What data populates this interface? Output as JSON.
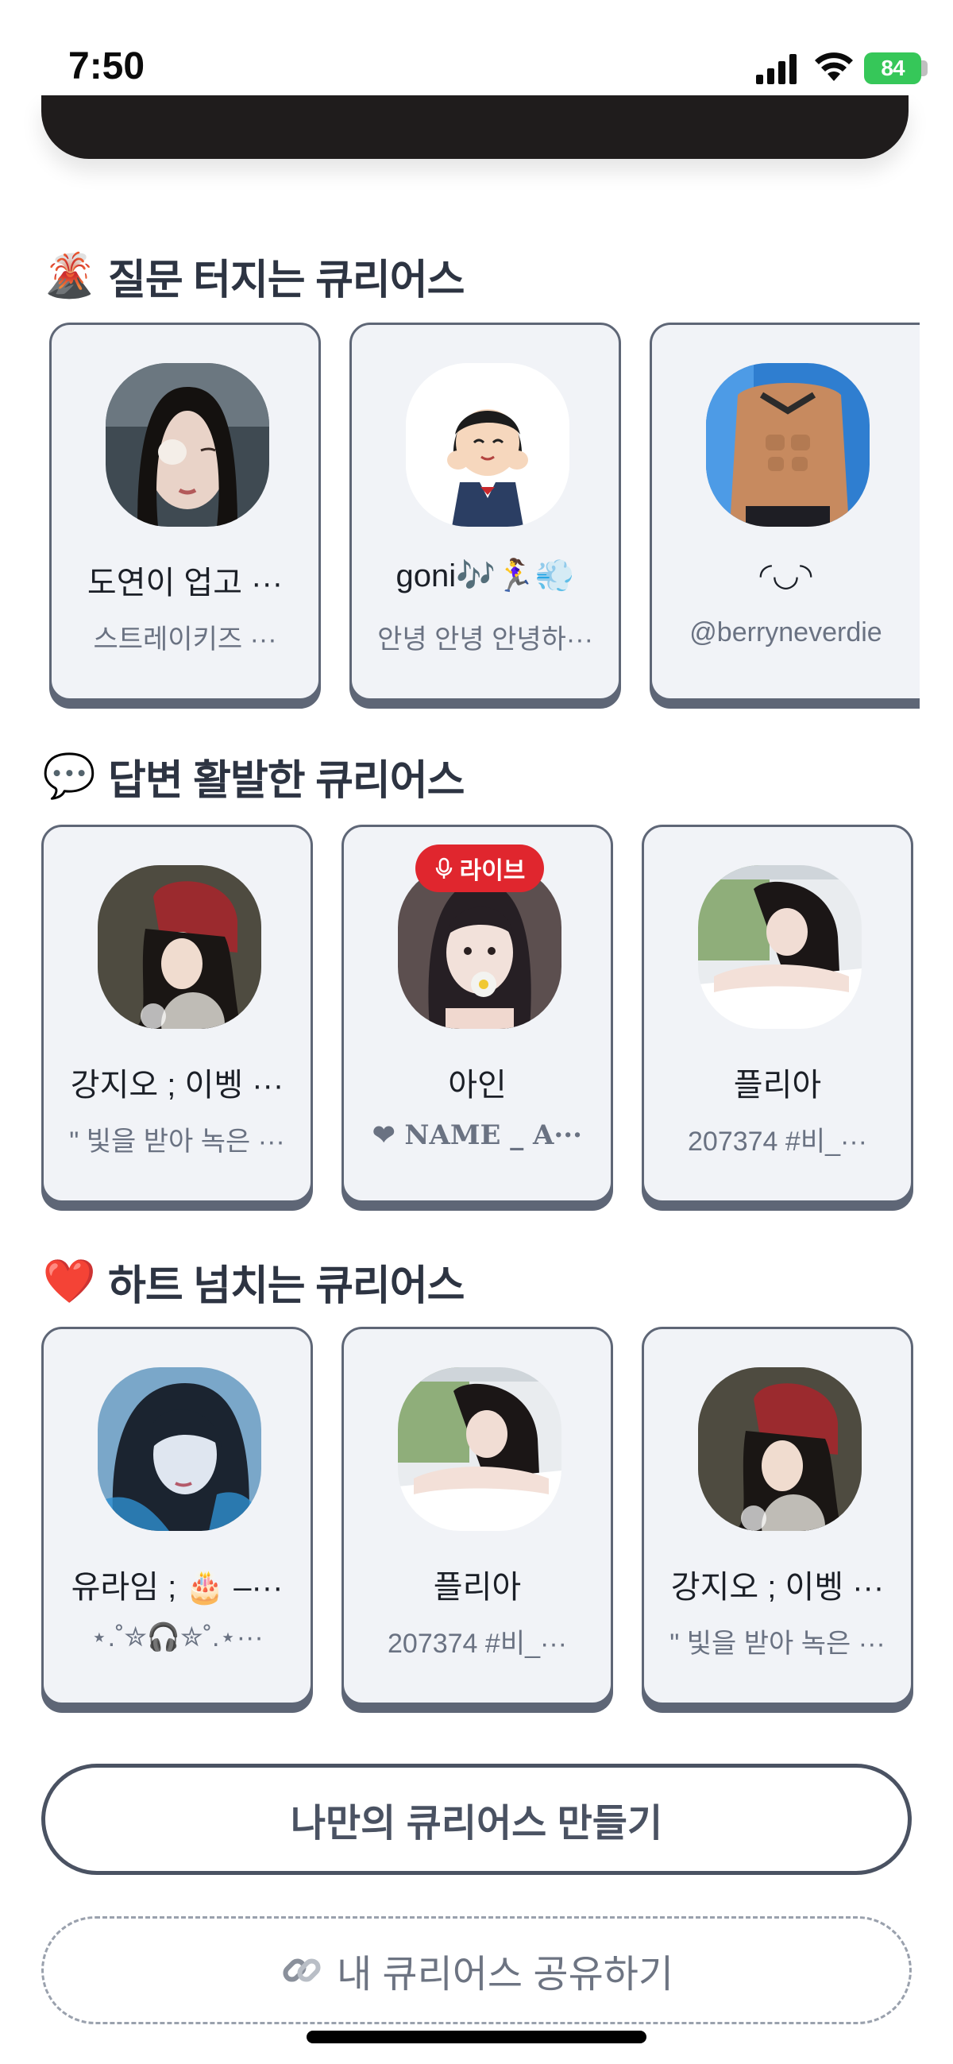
{
  "status_bar": {
    "time": "7:50",
    "battery": "84"
  },
  "sections": [
    {
      "emoji": "🌋",
      "title": "질문 터지는 큐리어스",
      "cards": [
        {
          "name": "도연이 업고 ···",
          "sub": "스트레이키즈 ···"
        },
        {
          "name": "goni🎶🏃‍♀️💨",
          "sub": "안녕 안녕 안녕하···"
        },
        {
          "name": "◜◡◝",
          "sub": "@berryneverdie"
        }
      ]
    },
    {
      "emoji": "💬",
      "title": "답변 활발한 큐리어스",
      "cards": [
        {
          "name": "강지오 ; 이벵 ···",
          "sub": "\" 빛을 받아 녹은 ···"
        },
        {
          "name": "아인",
          "sub": "❤ 𝐍𝐀𝐌𝐄 _ 𝐀···",
          "badge": "라이브"
        },
        {
          "name": "플리아",
          "sub": "207374 #비_···"
        }
      ]
    },
    {
      "emoji": "❤️",
      "title": "하트 넘치는 큐리어스",
      "cards": [
        {
          "name": "유라임 ; 🎂 –···",
          "sub": "⋆.˚✮🎧✮˚.⋆···"
        },
        {
          "name": "플리아",
          "sub": "207374 #비_···"
        },
        {
          "name": "강지오 ; 이벵 ···",
          "sub": "\" 빛을 받아 녹은 ···"
        }
      ]
    }
  ],
  "buttons": {
    "create_label": "나만의 큐리어스 만들기",
    "share_label": "내 큐리어스 공유하기",
    "share_icon": "link-icon"
  },
  "colors": {
    "card_bg": "#f1f3f7",
    "card_border": "#5e6676",
    "live_badge": "#e0262e",
    "battery": "#36c759"
  }
}
